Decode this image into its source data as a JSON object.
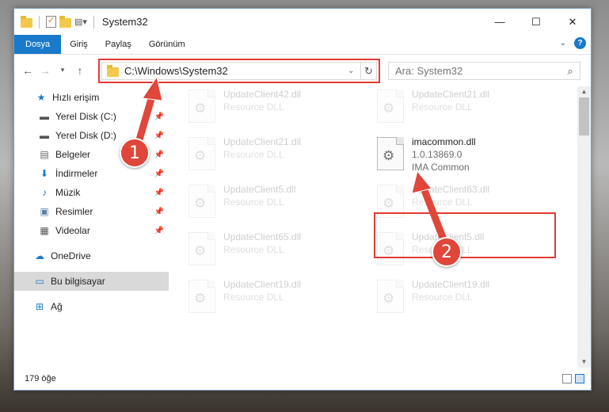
{
  "window": {
    "title": "System32",
    "controls": {
      "minimize": "—",
      "maximize": "☐",
      "close": "✕"
    }
  },
  "ribbon": {
    "tabs": [
      "Dosya",
      "Giriş",
      "Paylaş",
      "Görünüm"
    ],
    "help": "?"
  },
  "nav": {
    "address": "C:\\Windows\\System32",
    "search_placeholder": "Ara: System32"
  },
  "sidebar": {
    "items": [
      {
        "label": "Hızlı erişim",
        "icon": "star-icon"
      },
      {
        "label": "Yerel Disk (C:)",
        "icon": "drive-icon",
        "pinned": true
      },
      {
        "label": "Yerel Disk (D:)",
        "icon": "drive-icon",
        "pinned": true
      },
      {
        "label": "Belgeler",
        "icon": "documents-icon",
        "pinned": true
      },
      {
        "label": "İndirmeler",
        "icon": "download-icon",
        "pinned": true
      },
      {
        "label": "Müzik",
        "icon": "music-icon",
        "pinned": true
      },
      {
        "label": "Resimler",
        "icon": "pictures-icon",
        "pinned": true
      },
      {
        "label": "Videolar",
        "icon": "video-icon",
        "pinned": true
      },
      {
        "label": "OneDrive",
        "icon": "cloud-icon"
      },
      {
        "label": "Bu bilgisayar",
        "icon": "computer-icon",
        "selected": true
      },
      {
        "label": "Ağ",
        "icon": "network-icon"
      }
    ]
  },
  "files": [
    {
      "name": "UpdateClient42.dll",
      "meta1": "Resource DLL",
      "meta2": ""
    },
    {
      "name": "UpdateClient21.dll",
      "meta1": "Resource DLL",
      "meta2": ""
    },
    {
      "name": "UpdateClient21.dll",
      "meta1": "Resource DLL",
      "meta2": ""
    },
    {
      "name": "imacommon.dll",
      "meta1": "1.0.13869.0",
      "meta2": "IMA Common"
    },
    {
      "name": "UpdateClient5.dll",
      "meta1": "Resource DLL",
      "meta2": ""
    },
    {
      "name": "UpdateClient63.dll",
      "meta1": "Resource DLL",
      "meta2": ""
    },
    {
      "name": "UpdateClient65.dll",
      "meta1": "Resource DLL",
      "meta2": ""
    },
    {
      "name": "UpdateClient5.dll",
      "meta1": "Resource DLL",
      "meta2": ""
    },
    {
      "name": "UpdateClient19.dll",
      "meta1": "Resource DLL",
      "meta2": ""
    },
    {
      "name": "UpdateClient19.dll",
      "meta1": "Resource DLL",
      "meta2": ""
    }
  ],
  "status": {
    "count": "179 öğe"
  },
  "annotations": {
    "step1": "1",
    "step2": "2",
    "color": "#e53935"
  }
}
